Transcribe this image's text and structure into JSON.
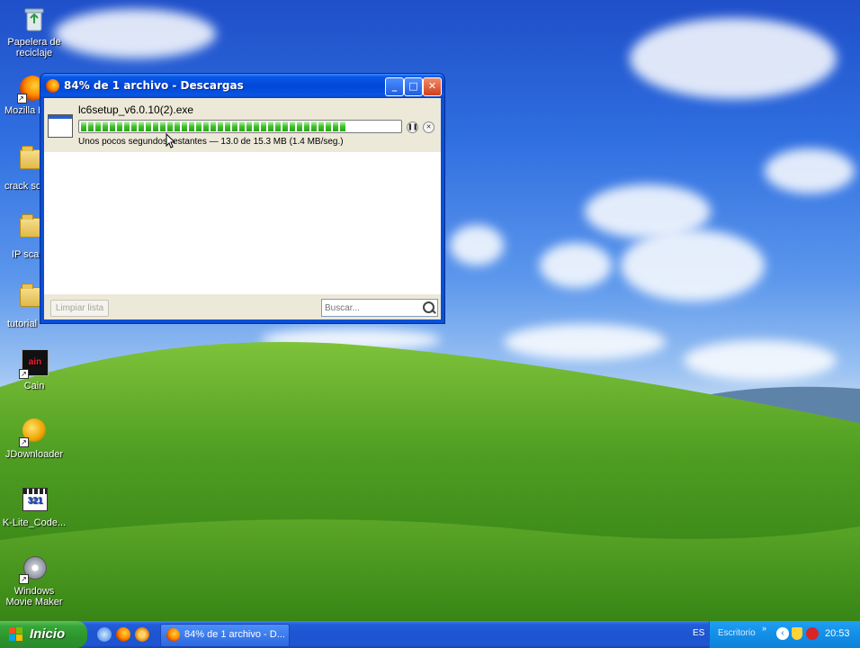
{
  "desktop": {
    "icons": [
      {
        "label": "Papelera de reciclaje",
        "icon": "recycle-bin-icon"
      },
      {
        "label": "Mozilla F",
        "icon": "firefox-icon"
      },
      {
        "label": "crack sof",
        "icon": "folder-icon"
      },
      {
        "label": "IP sca",
        "icon": "folder-icon"
      },
      {
        "label": "tutorial",
        "icon": "folder-icon"
      },
      {
        "label": "Cain",
        "icon": "cain-icon"
      },
      {
        "label": "JDownloader",
        "icon": "jdownloader-icon"
      },
      {
        "label": "K-Lite_Code...",
        "icon": "klite-icon"
      },
      {
        "label": "Windows Movie Maker",
        "icon": "movie-maker-icon"
      }
    ]
  },
  "window": {
    "title": "84% de 1 archivo - Descargas",
    "download": {
      "filename": "lc6setup_v6.0.10(2).exe",
      "status": "Unos pocos segundos restantes — 13.0 de 15.3 MB (1.4 MB/seg.)",
      "progress_percent": 84
    },
    "clear_button": "Limpiar lista",
    "search_placeholder": "Buscar..."
  },
  "taskbar": {
    "start_label": "Inicio",
    "task_label": "84% de 1 archivo - D...",
    "language": "ES",
    "desktop_toolbar": "Escritorio",
    "clock": "20:53"
  },
  "colors": {
    "titlebar": "#0047d8",
    "progress": "#3fbf2b",
    "start": "#37a537",
    "tray": "#1290e8"
  }
}
